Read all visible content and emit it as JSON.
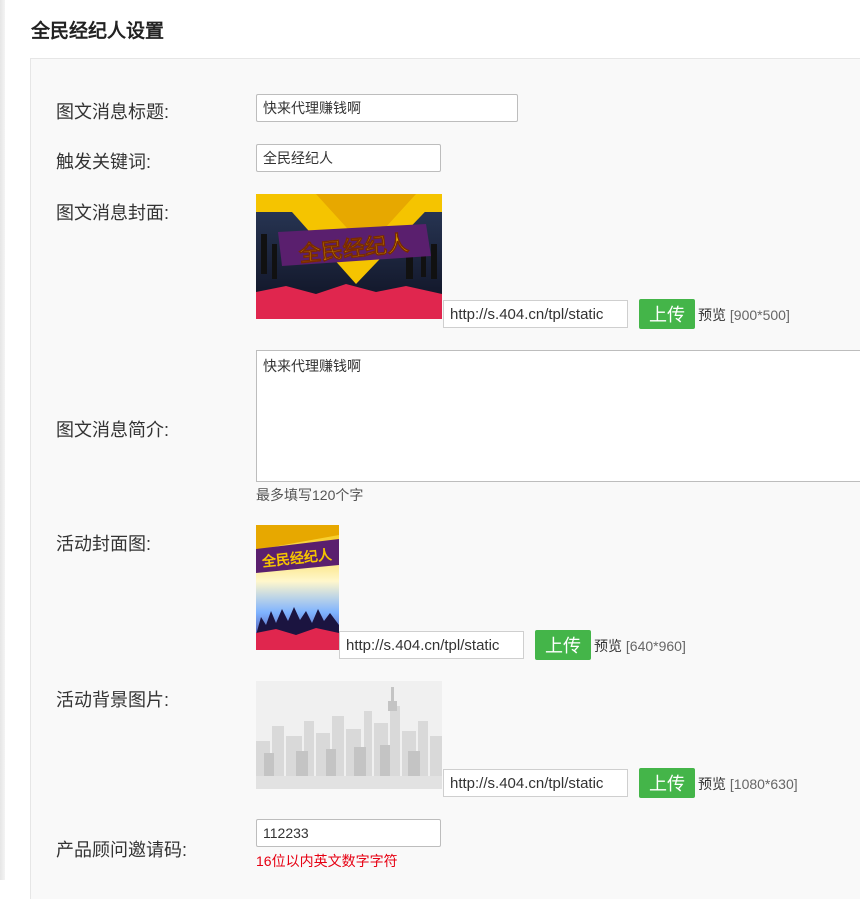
{
  "page_title": "全民经纪人设置",
  "fields": {
    "news_title": {
      "label": "图文消息标题:",
      "value": "快来代理赚钱啊"
    },
    "keyword": {
      "label": "触发关键词:",
      "value": "全民经纪人"
    },
    "cover": {
      "label": "图文消息封面:",
      "url": "http://s.404.cn/tpl/static",
      "upload_label": "上传",
      "preview_label": "预览",
      "size_hint": "[900*500]",
      "banner_text": "全民经纪人"
    },
    "summary": {
      "label": "图文消息简介:",
      "value": "快来代理赚钱啊",
      "hint": "最多填写120个字"
    },
    "activity_cover": {
      "label": "活动封面图:",
      "url": "http://s.404.cn/tpl/static",
      "upload_label": "上传",
      "preview_label": "预览",
      "size_hint": "[640*960]",
      "banner_text": "全民经纪人"
    },
    "activity_bg": {
      "label": "活动背景图片:",
      "url": "http://s.404.cn/tpl/static",
      "upload_label": "上传",
      "preview_label": "预览",
      "size_hint": "[1080*630]"
    },
    "invite_code": {
      "label": "产品顾问邀请码:",
      "value": "112233",
      "hint": "16位以内英文数字字符"
    }
  },
  "colors": {
    "accent_green": "#44b549",
    "hint_red": "#e60012",
    "banner_yellow": "#f5c400",
    "banner_red": "#e0264e",
    "banner_purple": "#5a1f6e"
  }
}
